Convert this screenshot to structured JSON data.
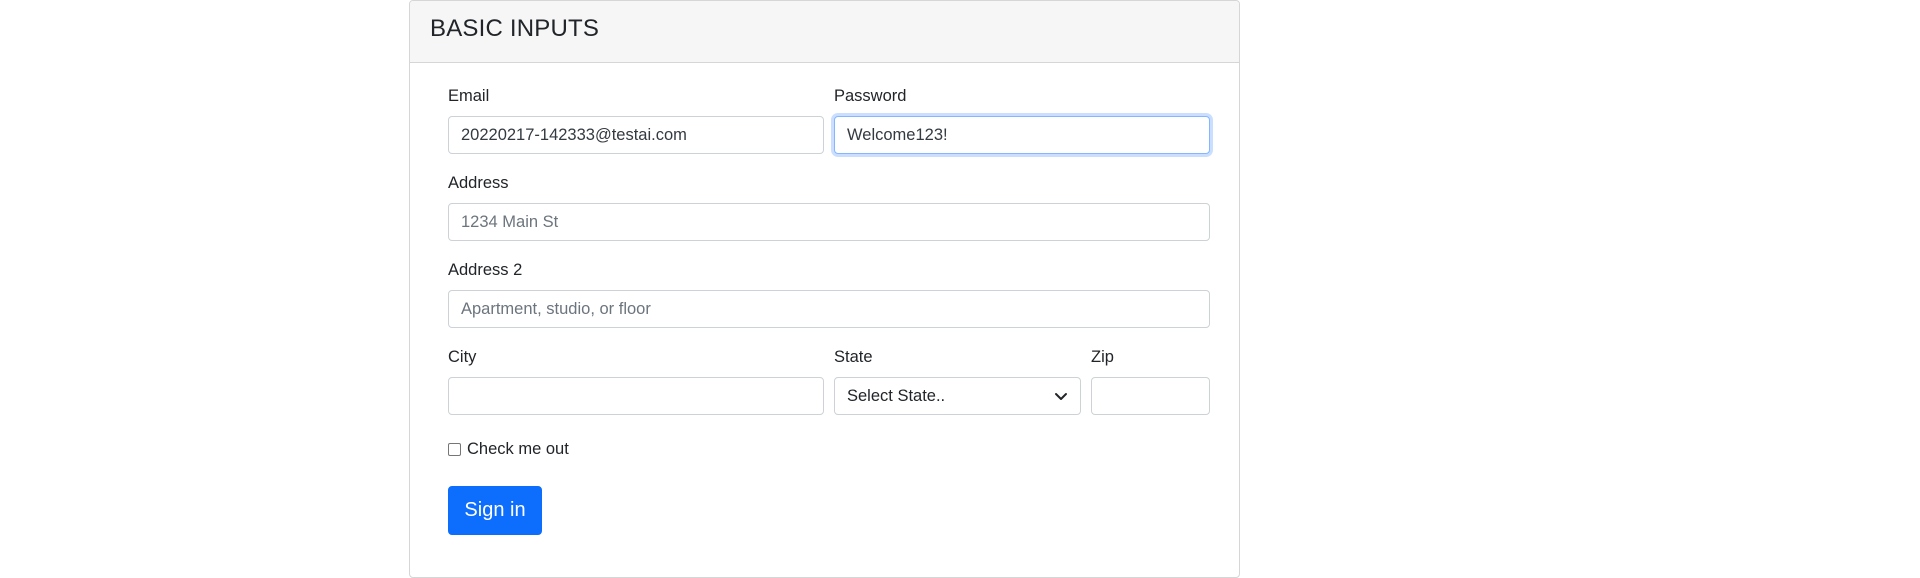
{
  "card": {
    "title": "BASIC INPUTS"
  },
  "form": {
    "email": {
      "label": "Email",
      "value": "20220217-142333@testai.com"
    },
    "password": {
      "label": "Password",
      "value": "Welcome123!"
    },
    "address": {
      "label": "Address",
      "placeholder": "1234 Main St"
    },
    "address2": {
      "label": "Address 2",
      "placeholder": "Apartment, studio, or floor"
    },
    "city": {
      "label": "City",
      "value": ""
    },
    "state": {
      "label": "State",
      "selected": "Select State.."
    },
    "zip": {
      "label": "Zip",
      "value": ""
    },
    "check": {
      "label": "Check me out",
      "checked": false
    },
    "submit": {
      "label": "Sign in"
    }
  },
  "colors": {
    "primary": "#0d6efd",
    "header_bg": "#f6f6f6",
    "border": "#d6d6d6",
    "focus_border": "#86b7fe"
  },
  "icons": {
    "select_arrow": "chevron-down-icon"
  }
}
